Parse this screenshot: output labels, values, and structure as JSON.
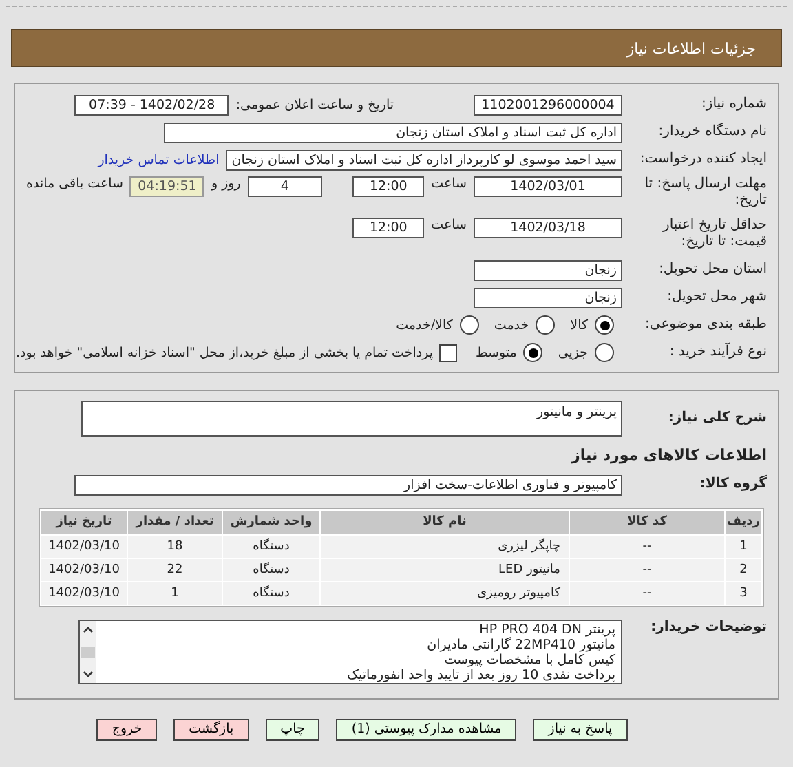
{
  "header": {
    "title": "جزئیات اطلاعات نیاز"
  },
  "details": {
    "need_number": {
      "label": "شماره نیاز:",
      "value": "1102001296000004"
    },
    "announce": {
      "label": "تاریخ و ساعت اعلان عمومی:",
      "value": "1402/02/28 - 07:39"
    },
    "buyer_org": {
      "label": "نام دستگاه خریدار:",
      "value": "اداره کل ثبت اسناد و املاک استان زنجان"
    },
    "requester": {
      "label": "ایجاد کننده درخواست:",
      "value": "سید احمد موسوی لو کارپرداز اداره کل ثبت اسناد و املاک استان زنجان",
      "link": "اطلاعات تماس خریدار"
    },
    "response_deadline": {
      "label": "مهلت ارسال پاسخ: تا تاریخ:",
      "date": "1402/03/01",
      "time_label": "ساعت",
      "time": "12:00",
      "days": "4",
      "days_label": "روز و",
      "remaining": "04:19:51",
      "remaining_label": "ساعت باقی مانده"
    },
    "price_validity": {
      "label": "حداقل تاریخ اعتبار قیمت: تا تاریخ:",
      "date": "1402/03/18",
      "time_label": "ساعت",
      "time": "12:00"
    },
    "province": {
      "label": "استان محل تحویل:",
      "value": "زنجان"
    },
    "city": {
      "label": "شهر محل تحویل:",
      "value": "زنجان"
    },
    "category": {
      "label": "طبقه بندی موضوعی:",
      "options": [
        {
          "label": "کالا",
          "selected": true
        },
        {
          "label": "خدمت",
          "selected": false
        },
        {
          "label": "کالا/خدمت",
          "selected": false
        }
      ]
    },
    "process": {
      "label": "نوع فرآیند خرید :",
      "options": [
        {
          "label": "جزیی",
          "selected": false
        },
        {
          "label": "متوسط",
          "selected": true
        }
      ],
      "payment": {
        "label": "پرداخت تمام یا بخشی از مبلغ خرید،از محل \"اسناد خزانه اسلامی\" خواهد بود.",
        "checked": false
      }
    }
  },
  "need_info": {
    "description": {
      "label": "شرح کلی نیاز:",
      "value": "پرینتر و مانیتور"
    },
    "goods_heading": "اطلاعات کالاهای مورد نیاز",
    "goods_group": {
      "label": "گروه کالا:",
      "value": "کامپیوتر و فناوری اطلاعات-سخت افزار"
    },
    "table": {
      "columns": [
        "ردیف",
        "کد کالا",
        "نام کالا",
        "واحد شمارش",
        "تعداد / مقدار",
        "تاریخ نیاز"
      ],
      "rows": [
        [
          "1",
          "--",
          "چاپگر لیزری",
          "دستگاه",
          "18",
          "1402/03/10"
        ],
        [
          "2",
          "--",
          "مانیتور LED",
          "دستگاه",
          "22",
          "1402/03/10"
        ],
        [
          "3",
          "--",
          "کامپیوتر رومیزی",
          "دستگاه",
          "1",
          "1402/03/10"
        ]
      ]
    },
    "buyer_notes": {
      "label": "توضیحات خریدار:",
      "lines": [
        "پرینتر HP PRO 404 DN",
        "مانیتور 22MP410 گارانتی مادیران",
        "کیس کامل با مشخصات پیوست",
        "پرداخت نقدی 10 روز بعد از تایید واحد انفورماتیک"
      ]
    }
  },
  "buttons": [
    {
      "label": "پاسخ به نیاز",
      "kind": "action"
    },
    {
      "label": "مشاهده مدارک پیوستی (1)",
      "kind": "action"
    },
    {
      "label": "چاپ",
      "kind": "action"
    },
    {
      "label": "بازگشت",
      "kind": "exit"
    },
    {
      "label": "خروج",
      "kind": "exit"
    }
  ]
}
